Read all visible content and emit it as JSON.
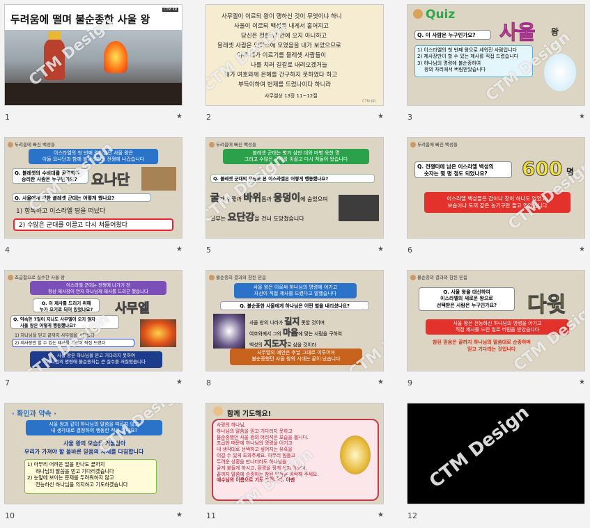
{
  "watermark": "CTM Design",
  "star": "★",
  "slides": [
    {
      "num": "1",
      "title": "두려움에 떨며 불순종한 사울 왕",
      "logo": "CTM KR"
    },
    {
      "num": "2",
      "lines": [
        "사무엘이 이르되 왕이 행하신 것이 무엇이냐 하니",
        "사울이 이르되 백성은 내게서 흩어지고",
        "당신은 정한 날 안에 오지 아니하고",
        "블레셋 사람은 믹마스에 모였음을 내가 보았으므로",
        "이에 내가 이르기를 블레셋 사람들이",
        "나를 치러 길갈로 내려오겠거늘",
        "내가 여호와께 은혜를 간구하지 못하였다 하고",
        "부득이하여 번제를 드렸나이다 하니라"
      ],
      "ref": "사무엘상 13장 11~12절",
      "logo": "CTM.KR"
    },
    {
      "num": "3",
      "quiz": "Quiz",
      "question": "Q. 이 사람은 누구인가요?",
      "answer": "사울",
      "answer_suffix": "왕",
      "options": [
        "1) 이스라엘의 첫 번째 왕으로 세워진 사람입니다",
        "2) 제사장만이 할 수 있는 제사를 직접 드렸습니다",
        "3) 하나님의 명령에 불순종하여",
        "왕의 자리에서 버림받았습니다"
      ]
    },
    {
      "num": "4",
      "header": "두려움에 빠진 백성들",
      "intro": [
        "이스라엘의 첫 번째 왕이었던 사울 왕은",
        "아들 요나단과 함께 블레셋과의 전쟁에 나갔습니다"
      ],
      "q1": [
        "Q. 블레셋의 수비대를 공격하여",
        "승리한 사람은 누구인가요?"
      ],
      "a1": "요나단",
      "q2": "Q. 사울에게 패한 블레셋 군대는 어떻게 했나요?",
      "opt1": "1) 항복하고 이스라엘 땅을 떠났다",
      "opt2": "2) 수많은 군대를 이끌고 다시 쳐들어왔다"
    },
    {
      "num": "5",
      "header": "두려움에 빠진 백성들",
      "intro": [
        "블레셋 군대는 병거 삼만 대와 마병 육천 명",
        "그리고 수많은 군사를 이끌고 다시 쳐들어 왔습니다"
      ],
      "question": "Q. 블레셋 군대의 모습을 본 이스라엘은 어떻게 행동했나요?",
      "l1a": "굴",
      "l1b": "과 수풀과",
      "l1c": "바위",
      "l1d": "틈과",
      "l1e": "웅덩이",
      "l1f": "에 숨었으며",
      "l2a": "일부는",
      "l2b": "요단강",
      "l2c": "을 건너 도망쳤습니다"
    },
    {
      "num": "6",
      "header": "두려움에 빠진 백성들",
      "question": [
        "Q. 전쟁터에 남은 이스라엘 백성의",
        "숫자는 몇 명 정도 되었나요?"
      ],
      "answer": "600",
      "answer_suffix": "명",
      "body": [
        "이스라엘 백성들은 갑이나 창이 하나도 없었고,",
        "보습이나 도끼 같은 농기구만 들고 있었습니다"
      ]
    },
    {
      "num": "7",
      "header": "조급함으로 실수한 사울 왕",
      "intro": [
        "이스라엘 군대는 전쟁에 나가기 전",
        "항상 제사장이 먼저 하나님께 제사를 드리곤 했습니다"
      ],
      "q1": [
        "Q. 이 제사를 드리기 위해",
        "누가 오기로 되어 있었나요?"
      ],
      "a1": "사무엘",
      "q2": [
        "Q. 약속한 7일이 지나도 사무엘이 오지 않자",
        "사울 왕은 어떻게 행동했나요?"
      ],
      "opt1": "1) 하나님을 믿고 끝까지 사무엘을 기다렸다",
      "opt2": "2) 제사장만 할 수 있는 제사를 자신이 직접 드렸다",
      "footer": [
        "사울 왕은 하나님을 믿고 기다리지 못하여",
        "하나님의 명령에 불순종하는 큰 실수를 저질렀습니다"
      ]
    },
    {
      "num": "8",
      "header": "불순종의 결과와 참된 믿음",
      "intro": [
        "사울 왕은 이로써 하나님의 명령에 어기고",
        "자신이 직접 제사를 드렸다고 말했습니다"
      ],
      "question": "Q. 불순종한 사울에게 하나님은 어떤 벌을 내리셨나요?",
      "l1a": "사울 왕의 나라가",
      "l1b": "길지",
      "l1c": "못할 것이며",
      "l2a": "여호와께서 그의",
      "l2b": "마음",
      "l2c": "에 맞는 사람을 구하여",
      "l3a": "백성의",
      "l3b": "지도자",
      "l3c": "로 삼을 것이라",
      "footer": [
        "사무엘의 예언은 후날 그대로 이루어져",
        "불순종했던 사울 왕의 시대는 끝이 났습니다"
      ]
    },
    {
      "num": "9",
      "header": "불순종의 결과와 참된 믿음",
      "question": [
        "Q. 사울 왕을 대신하여",
        "이스라엘의 새로운 왕으로",
        "선택받은 사람은 누구인가요?"
      ],
      "answer": "다윗",
      "body": [
        "사울 왕은 전능하신 하나님의 명령을 어기고",
        "직접 제사를 드린 일로 버림을 받았습니다",
        "참된 믿음은 끝까지 하나님의 말씀대로 순종하며",
        "믿고 기다리는 것입니다"
      ]
    },
    {
      "num": "10",
      "title": "· 확인과 약속 ·",
      "intro": [
        "사울 왕과 같이 하나님의 말씀을 따르지 않고",
        "내 생각대로 결정하여 행동한 적은 없나요?"
      ],
      "mid": [
        "사울 왕의 모습을 거울삼아",
        "우리가 가져야 할 올바른 믿음의 자세를 다짐합니다"
      ],
      "items": [
        "1) 아무리 어려운 일을 만나도 끝까지",
        "하나님의 말씀을 믿고 기다리겠습니다",
        "2) 눈앞에 보이는 문제를 두려워하지 않고",
        "전능하신 하나님을 의지하고 기도하겠습니다"
      ]
    },
    {
      "num": "11",
      "title": "함께 기도해요!",
      "lines": [
        "사랑의 하나님,",
        "하나님의 말씀을 믿고 기다리지 못하고",
        "불순종했던 사울 왕의 어리석은 모습을 봅니다.",
        "조급한 때문에 하나님의 명령을 어기고",
        "내 생각대로 선택하고 싶어지는 유혹을",
        "이길 수 있게 도와주세요. 아무리 힘들고",
        "두려운 상황을 만나더라도 하나님을",
        "굳게 붙들게 하시고, 환경을 핑계 삼지 않으며,",
        "끝까지 말씀에 순종하는 참된 믿음을 허락해 주세요."
      ],
      "closing": "예수님의 이름으로 기도 드립니다. 아멘"
    },
    {
      "num": "12"
    }
  ]
}
